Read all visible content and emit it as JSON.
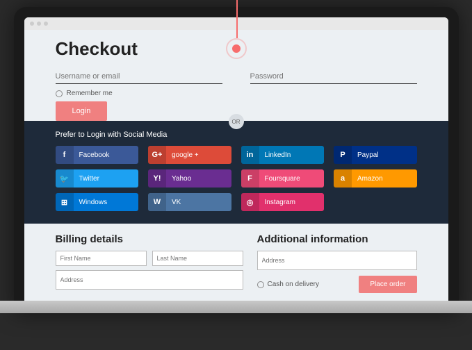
{
  "page_title": "Checkout",
  "login": {
    "username_placeholder": "Username or email",
    "password_placeholder": "Password",
    "remember_label": "Remember me",
    "login_button": "Login"
  },
  "divider_text": "OR",
  "social": {
    "title": "Prefer to Login with Social Media",
    "buttons": {
      "facebook": "Facebook",
      "twitter": "Twitter",
      "windows": "Windows",
      "google": "google +",
      "yahoo": "Yahoo",
      "vk": "VK",
      "linkedin": "LinkedIn",
      "foursquare": "Foursquare",
      "instagram": "Instagram",
      "paypal": "Paypal",
      "amazon": "Amazon"
    }
  },
  "billing": {
    "heading": "Billing details",
    "first_name": "First Name",
    "last_name": "Last Name",
    "address": "Address"
  },
  "additional": {
    "heading": "Additional information",
    "address": "Address",
    "cod_label": "Cash on delivery",
    "place_order": "Place order"
  }
}
